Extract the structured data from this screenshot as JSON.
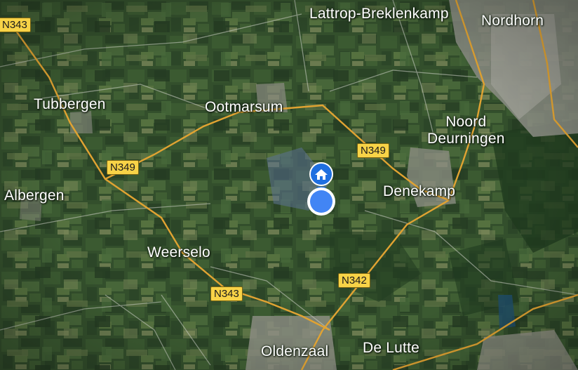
{
  "map": {
    "places": {
      "lattrop": "Lattrop-Breklenkamp",
      "nordhorn": "Nordhorn",
      "tubbergen": "Tubbergen",
      "ootmarsum": "Ootmarsum",
      "noord": "Noord",
      "deurningen": "Deurningen",
      "denekamp": "Denekamp",
      "albergen": "Albergen",
      "weerselo": "Weerselo",
      "oldenzaal": "Oldenzaal",
      "de_lutte": "De Lutte"
    },
    "road_shields": {
      "n343_top": "N343",
      "n349_left": "N349",
      "n349_right": "N349",
      "n342": "N342",
      "n343_bottom": "N343"
    },
    "markers": {
      "home_icon": "home-icon",
      "location_icon": "current-location-icon"
    },
    "colors": {
      "road": "#e1a332",
      "shield_fill": "#f8d347",
      "location_blue": "#4285f4",
      "terrain": "#2f4a2a"
    }
  }
}
